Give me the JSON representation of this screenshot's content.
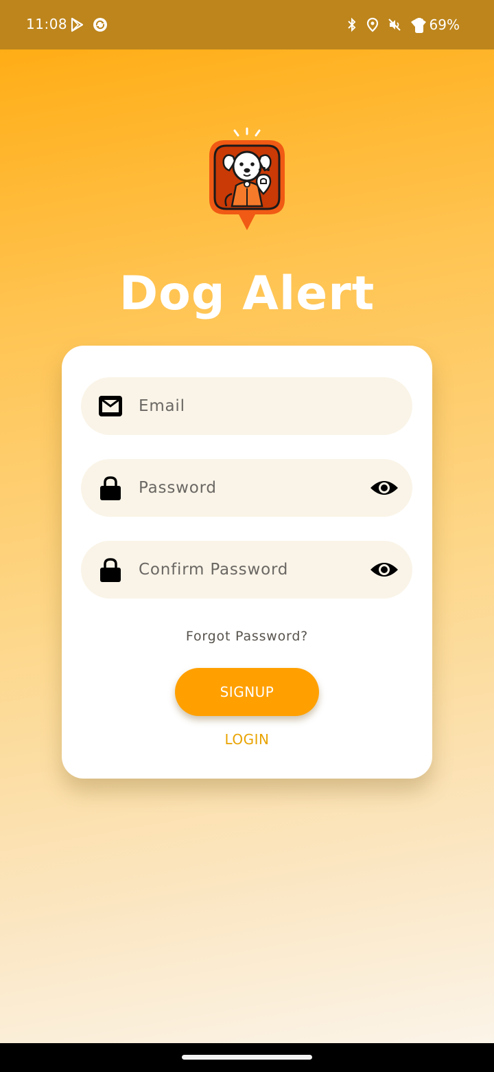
{
  "status_bar": {
    "time": "11:08",
    "battery": "69%",
    "left_icons": [
      "play-store-icon",
      "sync-app-icon"
    ],
    "right_icons": [
      "bluetooth-icon",
      "location-icon",
      "mute-icon",
      "wifi-icon",
      "battery-icon"
    ]
  },
  "app": {
    "title": "Dog Alert",
    "logo": "dog-alert-logo"
  },
  "form": {
    "email_placeholder": "Email",
    "password_placeholder": "Password",
    "confirm_password_placeholder": "Confirm Password",
    "forgot_password": "Forgot Password?",
    "signup_label": "SIGNUP",
    "login_label": "LOGIN"
  },
  "colors": {
    "accent": "#ffa000",
    "link": "#e9a300",
    "status_bar": "#bd851c",
    "logo_orange": "#f05a14"
  }
}
